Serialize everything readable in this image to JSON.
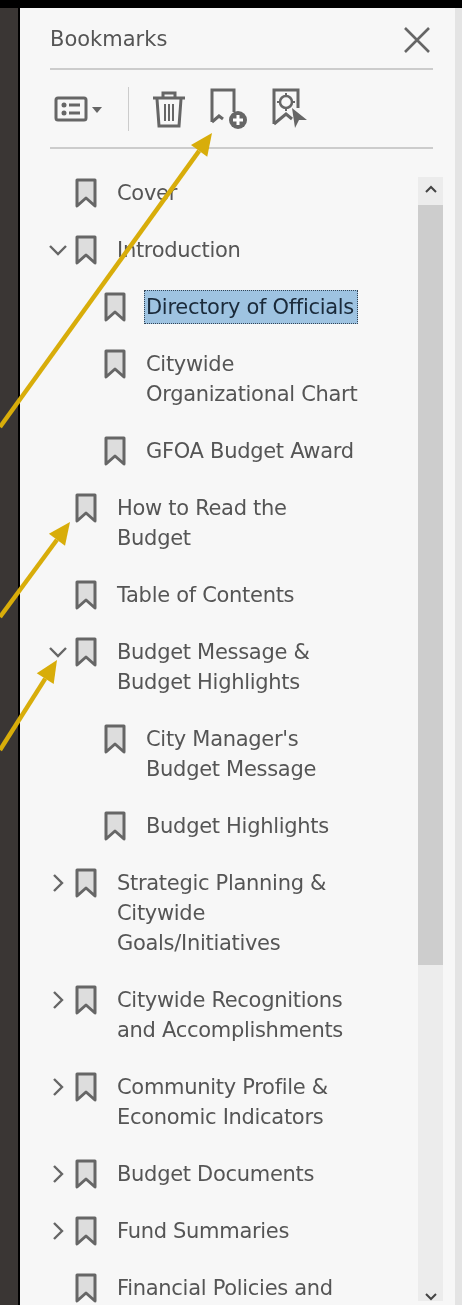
{
  "panel": {
    "title": "Bookmarks"
  },
  "toolbar": [
    {
      "kind": "options"
    },
    {
      "kind": "divider"
    },
    {
      "kind": "delete"
    },
    {
      "kind": "new-bookmark"
    },
    {
      "kind": "find-bookmark"
    }
  ],
  "bookmarks": [
    {
      "label": "Cover",
      "selected": false
    },
    {
      "label": "Introduction",
      "selected": false,
      "expanded": true,
      "children": [
        {
          "label": "Directory of Officials",
          "selected": true
        },
        {
          "label": "Citywide\nOrganizational Chart",
          "selected": false
        },
        {
          "label": "GFOA Budget Award",
          "selected": false
        }
      ]
    },
    {
      "label": "How to Read the\nBudget",
      "selected": false
    },
    {
      "label": "Table of Contents",
      "selected": false
    },
    {
      "label": "Budget Message &\nBudget Highlights",
      "selected": false,
      "expanded": true,
      "children": [
        {
          "label": "City Manager's\nBudget Message",
          "selected": false
        },
        {
          "label": "Budget Highlights",
          "selected": false
        }
      ]
    },
    {
      "label": "Strategic Planning &\nCitywide\nGoals/Initiatives",
      "selected": false,
      "expanded": false
    },
    {
      "label": "Citywide Recognitions\nand Accomplishments",
      "selected": false,
      "expanded": false
    },
    {
      "label": "Community Profile &\nEconomic Indicators",
      "selected": false,
      "expanded": false
    },
    {
      "label": "Budget Documents",
      "selected": false,
      "expanded": false
    },
    {
      "label": "Fund Summaries",
      "selected": false,
      "expanded": false
    },
    {
      "label": "Financial Policies and",
      "selected": false
    }
  ]
}
